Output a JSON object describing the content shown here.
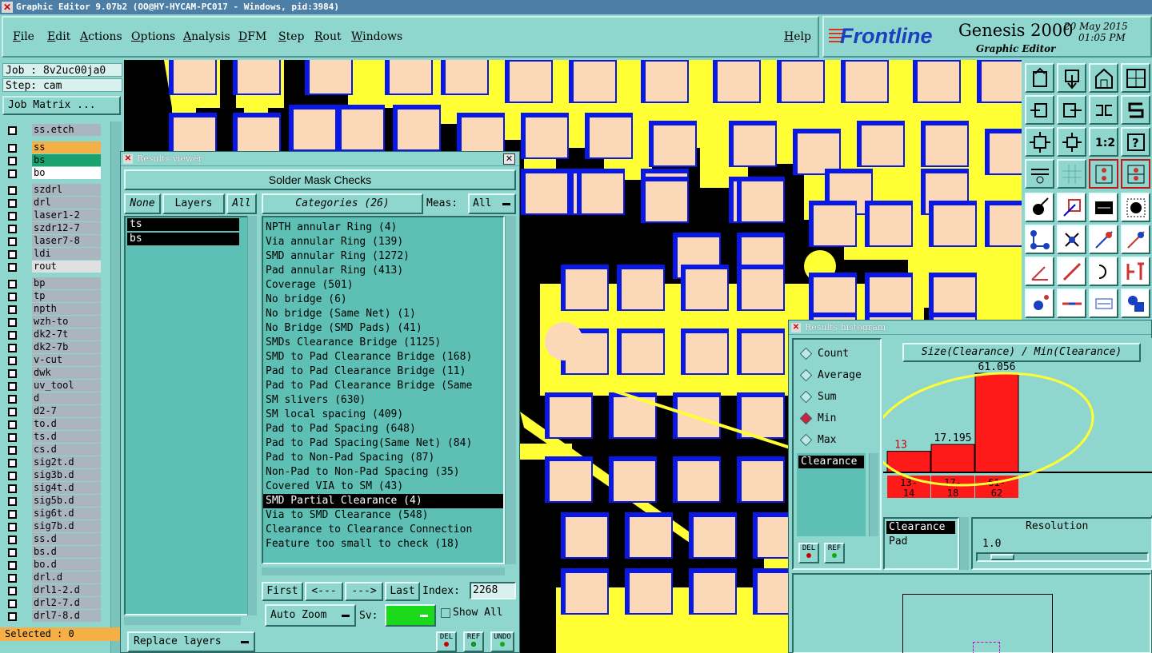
{
  "window_title": "Graphic Editor 9.07b2 (OO@HY-HYCAM-PC017 - Windows, pid:3984)",
  "menu": [
    "File",
    "Edit",
    "Actions",
    "Options",
    "Analysis",
    "DFM",
    "Step",
    "Rout",
    "Windows"
  ],
  "help": "Help",
  "brand": {
    "logo": "Frontline",
    "product": "Genesis 2000",
    "subtitle": "Graphic Editor",
    "date": "20 May 2015",
    "time": "01:05 PM"
  },
  "colors": {
    "panel": "#8fd6cf",
    "list_bg": "#5ec0b4",
    "board_yellow": "#ffff33",
    "pad_peach": "#fbd9b8",
    "pad_outline_blue": "#0a18e6",
    "bar_red": "#ff1a1a",
    "selected_orange": "#f4b046"
  },
  "left": {
    "job": "Job : 8v2uc00ja0",
    "step": "Step: cam",
    "job_matrix": "Job Matrix ...",
    "group1": [
      {
        "name": "ss.etch",
        "color": "#a9b5bf"
      }
    ],
    "group2": [
      {
        "name": "ss",
        "color": "#f4b046"
      },
      {
        "name": "bs",
        "color": "#1aa36f"
      },
      {
        "name": "bo",
        "color": "#ffffff"
      }
    ],
    "group3": [
      {
        "name": "szdrl",
        "color": "#a9b5bf"
      },
      {
        "name": "drl",
        "color": "#a9b5bf"
      },
      {
        "name": "laser1-2",
        "color": "#a9b5bf"
      },
      {
        "name": "szdr12-7",
        "color": "#a9b5bf"
      },
      {
        "name": "laser7-8",
        "color": "#a9b5bf"
      },
      {
        "name": "ldi",
        "color": "#a9b5bf"
      },
      {
        "name": "rout",
        "color": "#e0e0e0"
      }
    ],
    "group4": [
      {
        "name": "bp"
      },
      {
        "name": "tp"
      },
      {
        "name": "npth"
      },
      {
        "name": "wzh-to"
      },
      {
        "name": "dk2-7t"
      },
      {
        "name": "dk2-7b"
      },
      {
        "name": "v-cut"
      },
      {
        "name": "dwk"
      },
      {
        "name": "uv_tool"
      },
      {
        "name": "d"
      },
      {
        "name": "d2-7"
      },
      {
        "name": "to.d"
      },
      {
        "name": "ts.d"
      },
      {
        "name": "cs.d"
      },
      {
        "name": "sig2t.d"
      },
      {
        "name": "sig3b.d"
      },
      {
        "name": "sig4t.d"
      },
      {
        "name": "sig5b.d"
      },
      {
        "name": "sig6t.d"
      },
      {
        "name": "sig7b.d"
      },
      {
        "name": "ss.d"
      },
      {
        "name": "bs.d"
      },
      {
        "name": "bo.d"
      },
      {
        "name": "drl.d"
      },
      {
        "name": "drl1-2.d"
      },
      {
        "name": "drl2-7.d"
      },
      {
        "name": "drl7-8.d"
      }
    ],
    "selected": "Selected : 0"
  },
  "results_viewer": {
    "title": "Results viewer",
    "header": "Solder Mask Checks",
    "none_btn": "None",
    "layers_btn": "Layers",
    "all_btn": "All",
    "categories_btn": "Categories (26)",
    "meas_label": "Meas:",
    "meas_value": "All",
    "layers": [
      "ts",
      "bs"
    ],
    "categories": [
      "NPTH annular Ring (4)",
      "Via annular Ring (139)",
      "SMD annular Ring (1272)",
      "Pad annular Ring (413)",
      "Coverage (501)",
      "No bridge (6)",
      "No bridge (Same Net) (1)",
      "No Bridge (SMD Pads) (41)",
      "SMDs Clearance Bridge (1125)",
      "SMD to Pad Clearance Bridge (168)",
      "Pad to Pad Clearance Bridge (11)",
      "Pad to Pad Clearance Bridge (Same",
      "SM slivers (630)",
      "SM local spacing (409)",
      "Pad to Pad Spacing (648)",
      "Pad to Pad Spacing(Same Net) (84)",
      "Pad to Non-Pad Spacing (87)",
      "Non-Pad to Non-Pad Spacing (35)",
      "Covered VIA to SM (43)",
      "SMD Partial Clearance (4)",
      "Via to SMD Clearance (548)",
      "Clearance to Clearance Connection",
      "Feature too small to check (18)"
    ],
    "selected_category": "SMD Partial Clearance (4)",
    "first": "First",
    "prev": "<---",
    "next": "--->",
    "last": "Last",
    "index_label": "Index:",
    "index_value": "2268",
    "auto_zoom": "Auto Zoom",
    "sv_label": "Sv:",
    "show_all": "Show All",
    "replace_layers": "Replace layers",
    "del": "DEL",
    "ref": "REF",
    "undo": "UNDO"
  },
  "histogram": {
    "title": "Results histogram",
    "modes": [
      "Count",
      "Average",
      "Sum",
      "Min",
      "Max"
    ],
    "selected_mode": "Min",
    "list_item": "Clearance",
    "chart_title": "Size(Clearance) / Min(Clearance)",
    "bars": [
      {
        "label": "13",
        "value": 13,
        "range": [
          "13-",
          "14"
        ]
      },
      {
        "label": "17.195",
        "value": 17.195,
        "range": [
          "17-",
          "18"
        ]
      },
      {
        "label": "61.056",
        "value": 61.056,
        "range": [
          "61-",
          "62"
        ]
      }
    ],
    "attr_items": [
      "Clearance",
      "Pad"
    ],
    "resolution_label": "Resolution",
    "resolution_value": "1.0",
    "del": "DEL",
    "ref": "REF"
  }
}
